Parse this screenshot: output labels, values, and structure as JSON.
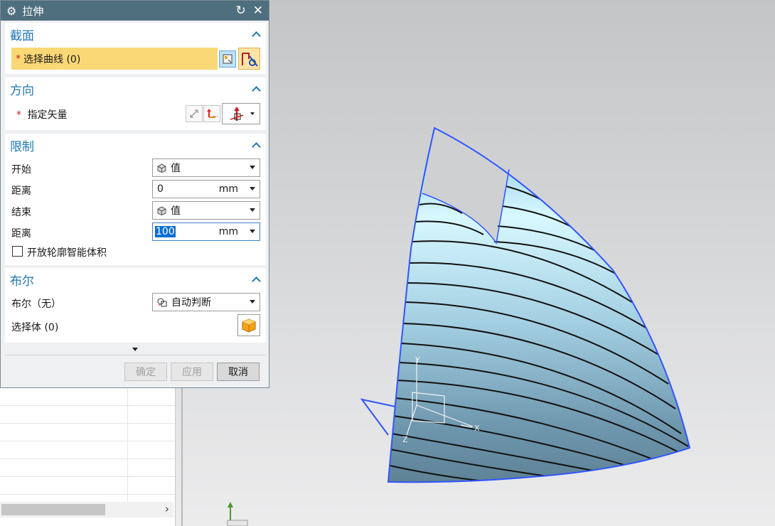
{
  "dialog": {
    "title": "拉伸",
    "section": {
      "title": "截面",
      "select_curve_required": "*",
      "select_curve_label": "选择曲线 (0)"
    },
    "direction": {
      "title": "方向",
      "vector_required": "*",
      "vector_label": "指定矢量"
    },
    "limits": {
      "title": "限制",
      "start_label": "开始",
      "start_value": "值",
      "start_distance_label": "距离",
      "start_distance_value": "0",
      "start_distance_unit": "mm",
      "end_label": "结束",
      "end_value": "值",
      "end_distance_label": "距离",
      "end_distance_value": "100",
      "end_distance_unit": "mm",
      "open_profile_label": "开放轮廓智能体积"
    },
    "boolean": {
      "title": "布尔",
      "bool_label": "布尔（无）",
      "bool_value": "自动判断",
      "select_body_label": "选择体 (0)"
    },
    "buttons": {
      "ok": "确定",
      "apply": "应用",
      "cancel": "取消"
    }
  },
  "viewport": {
    "triad": {
      "x": "X",
      "y": "Y",
      "z": "Z"
    },
    "colors": {
      "surface_edge": "#2f55ff",
      "background_top": "#c4c5c7",
      "background_bottom": "#ececed"
    }
  }
}
